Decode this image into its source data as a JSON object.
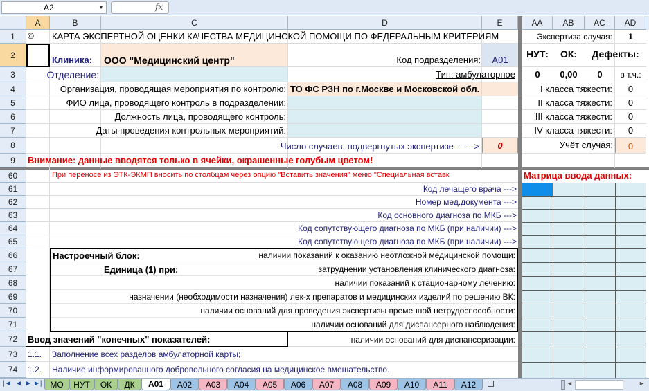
{
  "formula_bar": {
    "name_box": "A2",
    "fx_label": "fx",
    "formula": ""
  },
  "columns": [
    "A",
    "B",
    "C",
    "D",
    "E",
    "AA",
    "AB",
    "AC",
    "AD"
  ],
  "rows": [
    "1",
    "2",
    "3",
    "4",
    "5",
    "6",
    "7",
    "8",
    "9",
    "60",
    "61",
    "62",
    "63",
    "64",
    "65",
    "66",
    "67",
    "68",
    "69",
    "70",
    "71",
    "72",
    "73",
    "74"
  ],
  "row1": {
    "a": "©",
    "title": "КАРТА ЭКСПЕРТНОЙ ОЦЕНКИ КАЧЕСТВА МЕДИЦИНСКОЙ ПОМОЩИ ПО ФЕДЕРАЛЬНЫМ КРИТЕРИЯМ",
    "exp_label": "Экспертиза случая:",
    "exp_value": "1"
  },
  "row2": {
    "clinic_label": "Клиника:",
    "clinic_value": "ООО \"Медицинский центр\"",
    "dept_code_label": "Код подразделения:",
    "dept_code_value": "A01",
    "nut": "НУТ:",
    "ok": "ОК:",
    "defects": "Дефекты:"
  },
  "row3": {
    "dept_label": "Отделение:",
    "type_label": "Тип: амбулаторное",
    "nut_val": "0",
    "ok_val": "0,00",
    "def_val": "0",
    "vtch": "в т.ч.:"
  },
  "row4": {
    "org_label": "Организация, проводящая мероприятия по контролю:",
    "org_value": "ТО ФС РЗН по г.Москве и Московской обл.",
    "cls1": "I класса тяжести:",
    "cls1_v": "0"
  },
  "row5": {
    "label": "ФИО лица, проводящего контроль в подразделении:",
    "cls2": "II класса тяжести:",
    "cls2_v": "0"
  },
  "row6": {
    "label": "Должность лица, проводящего контроль:",
    "cls3": "III класса тяжести:",
    "cls3_v": "0"
  },
  "row7": {
    "label": "Даты проведения контрольных мероприятий:",
    "cls4": "IV класса тяжести:",
    "cls4_v": "0"
  },
  "row8": {
    "label": "Число случаев, подвергнутых экспертизе ------>",
    "value": "0",
    "count_label": "Учёт случая:",
    "count_value": "0"
  },
  "row9": {
    "warning": "Внимание: данные вводятся только в ячейки, окрашенные голубым цветом!"
  },
  "row60": {
    "note": "При переносе из ЭТК-ЭКМП вносить по столбцам через опцию \"Вставить значения\" меню \"Специальная вставк",
    "matrix_label": "Матрица ввода данных:"
  },
  "row61": "Код лечащего врача --->",
  "row62": "Номер мед.документа --->",
  "row63": "Код основного диагноза по МКБ --->",
  "row64": "Код сопутствующего диагноза по МКБ (при наличии) --->",
  "row65": "Код сопутствующего диагноза по МКБ (при наличии) --->",
  "row66": {
    "block": "Настроечный блок:",
    "text": "наличии показаний к оказанию неотложной медицинской помощи:"
  },
  "row67": {
    "unit": "Единица (1) при:",
    "text": "затруднении установления клинического диагноза:"
  },
  "row68": "наличии показаний к стационарному лечению:",
  "row69": "назначении (необходимости назначения) лек-х препаратов и медицинских изделий по решению ВК:",
  "row70": "наличии оснований для проведения экспертизы временной нетрудоспособности:",
  "row71": "наличии оснований для диспансерного наблюдения:",
  "row72": {
    "input": "Ввод значений \"конечных\" показателей:",
    "text": "наличии оснований для диспансеризации:"
  },
  "row73": {
    "num": "1.1.",
    "text": "Заполнение всех разделов амбулаторной карты;"
  },
  "row74": {
    "num": "1.2.",
    "text": "Наличие информированного добровольного согласия на медицинское вмешательство."
  },
  "sheet_tabs": [
    "МО",
    "НУТ",
    "ОК",
    "ДК",
    "А01",
    "А02",
    "А03",
    "А04",
    "А05",
    "А06",
    "А07",
    "А08",
    "А09",
    "А10",
    "А11",
    "А12"
  ],
  "active_tab": "А01",
  "colors": {
    "cell_blue": "#daeef3",
    "cell_peach": "#fde9d9",
    "header_selected": "#f9d99f",
    "tab_green": "#a9d08e",
    "tab_pink": "#f4b6c2",
    "tab_blue": "#9dc3e6"
  }
}
